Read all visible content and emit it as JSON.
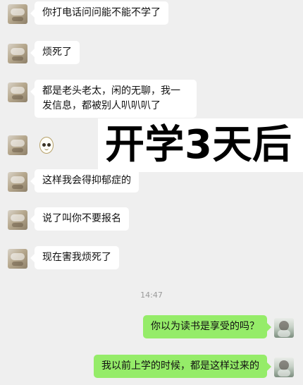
{
  "messages": [
    {
      "side": "left",
      "type": "text",
      "text": "你打电话问问能不能不学了"
    },
    {
      "side": "left",
      "type": "text",
      "text": "烦死了"
    },
    {
      "side": "left",
      "type": "text",
      "text": "都是老头老太，闲的无聊，我一发信息，都被别人叭叭叭了"
    },
    {
      "side": "left",
      "type": "sticker",
      "sticker": "owl-sticker"
    },
    {
      "side": "left",
      "type": "text",
      "text": "这样我会得抑郁症的"
    },
    {
      "side": "left",
      "type": "text",
      "text": "说了叫你不要报名"
    },
    {
      "side": "left",
      "type": "text",
      "text": "现在害我烦死了"
    },
    {
      "side": "right",
      "type": "text",
      "text": "你以为读书是享受的吗？"
    },
    {
      "side": "right",
      "type": "text",
      "text": "我以前上学的时候，都是这样过来的"
    }
  ],
  "time_label": "14:47",
  "overlay_text": "开学3天后",
  "colors": {
    "background": "#efefef",
    "incoming_bubble": "#ffffff",
    "outgoing_bubble": "#95ec69",
    "time_text": "#9a9a9a"
  },
  "icons": {
    "incoming_avatar": "parent-avatar",
    "outgoing_avatar": "user-avatar",
    "sticker": "owl-sticker"
  }
}
